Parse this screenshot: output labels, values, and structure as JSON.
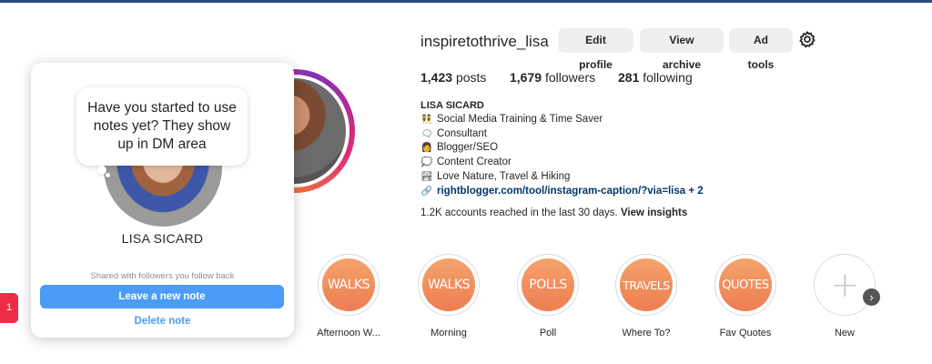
{
  "profile": {
    "username": "inspiretothrive_lisa",
    "buttons": {
      "edit": "Edit profile",
      "archive": "View archive",
      "adtools": "Ad tools"
    },
    "icons": {
      "settings": "gear-icon"
    },
    "stats": {
      "posts_count": "1,423",
      "posts_label": "posts",
      "followers_count": "1,679",
      "followers_label": "followers",
      "following_count": "281",
      "following_label": "following"
    },
    "bio": {
      "name": "LISA SICARD",
      "lines": [
        {
          "emoji": "👯",
          "text": "Social Media Training & Time Saver"
        },
        {
          "emoji": "🗨",
          "text": "Consultant"
        },
        {
          "emoji": "👩",
          "text": "Blogger/SEO"
        },
        {
          "emoji": "💭",
          "text": "Content Creator"
        },
        {
          "emoji": "🏞",
          "text": "Love Nature, Travel & Hiking"
        }
      ],
      "link_icon": "🔗",
      "link": "rightblogger.com/tool/instagram-caption/?via=lisa + 2"
    },
    "insights": {
      "text": "1.2K accounts reached in the last 30 days.",
      "link": "View insights"
    }
  },
  "highlights": [
    {
      "cover": "WALKS",
      "label": "Afternoon W..."
    },
    {
      "cover": "WALKS",
      "label": "Morning"
    },
    {
      "cover": "POLLS",
      "label": "Poll"
    },
    {
      "cover": "TRAVELS",
      "label": "Where To?"
    },
    {
      "cover": "QUOTES",
      "label": "Fav Quotes"
    },
    {
      "cover": "+",
      "label": "New"
    }
  ],
  "notes_popup": {
    "bubble_text": "Have you started to use notes yet? They show up in DM area",
    "name": "LISA SICARD",
    "shared_text": "Shared with followers you follow back",
    "leave_button": "Leave a new note",
    "delete_button": "Delete note"
  },
  "notification_badge": "1",
  "colors": {
    "accent": "#4a9cf6",
    "highlight_orange": "#ee7d52",
    "topbar": "#2f4a7d",
    "badge": "#ed2c47"
  }
}
